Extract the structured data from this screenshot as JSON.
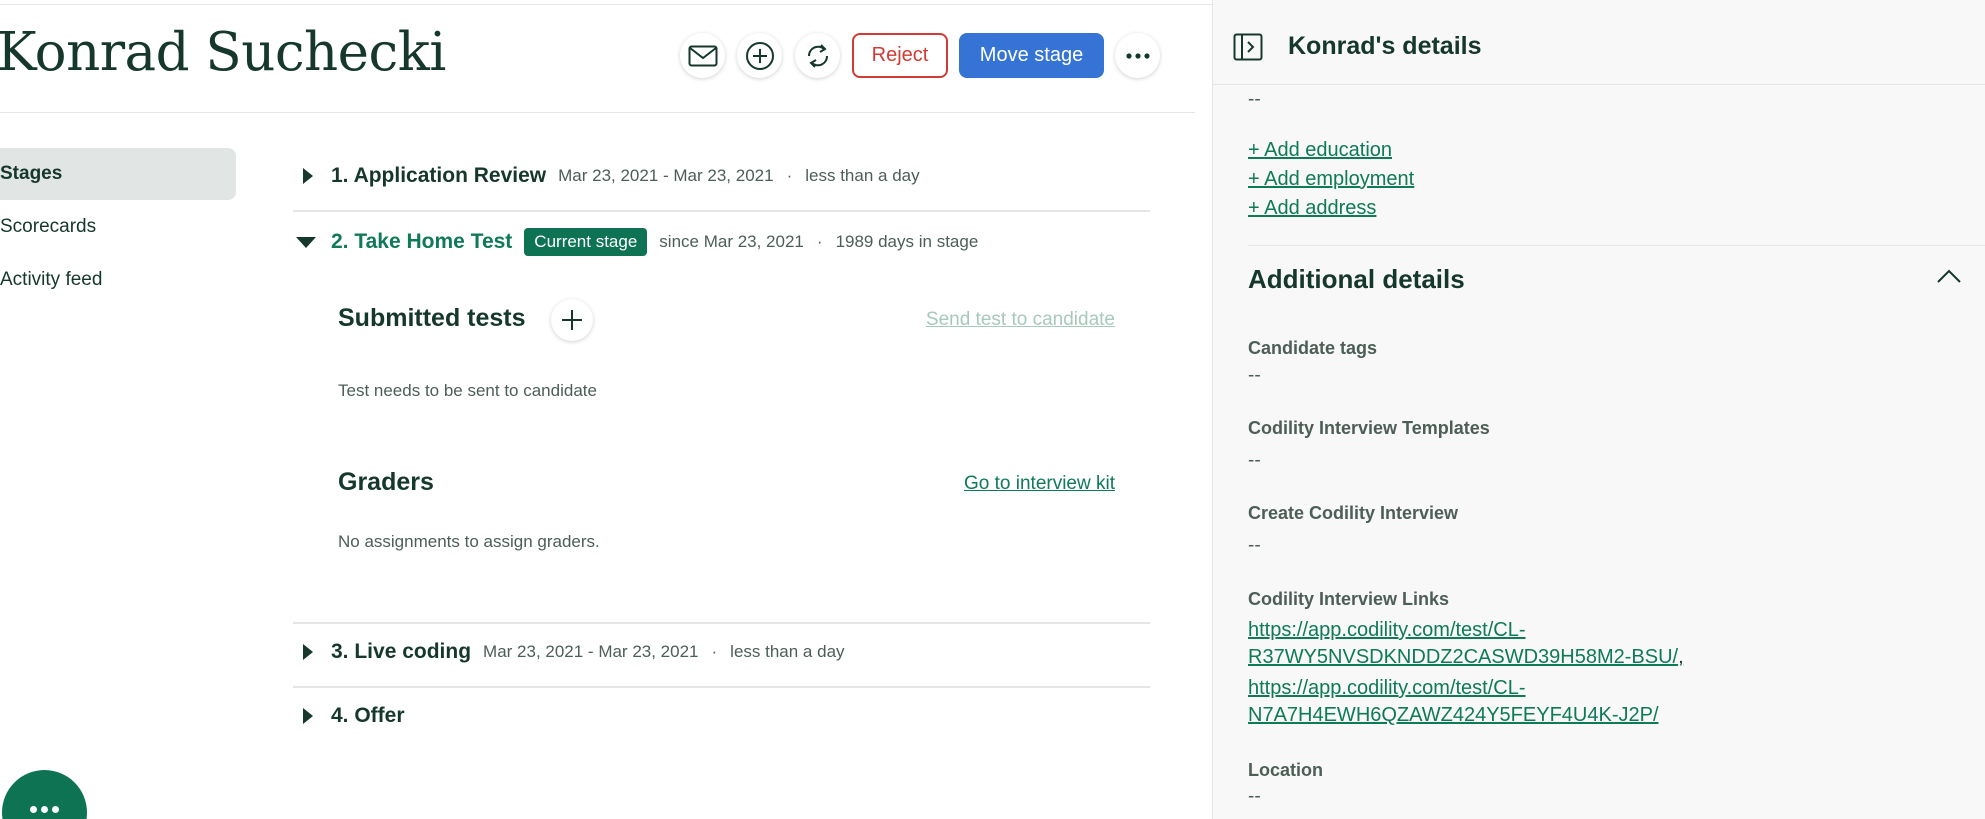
{
  "candidate": {
    "name": "Konrad Suchecki"
  },
  "actions": {
    "reject_label": "Reject",
    "move_stage_label": "Move stage"
  },
  "nav": {
    "items": [
      {
        "label": "Stages"
      },
      {
        "label": "Scorecards"
      },
      {
        "label": "Activity feed"
      }
    ]
  },
  "stages": [
    {
      "title": "1. Application Review",
      "dates": "Mar 23, 2021 - Mar 23, 2021",
      "duration": "less than a day"
    },
    {
      "title": "2. Take Home Test",
      "badge": "Current stage",
      "dates": "since Mar 23, 2021",
      "duration": "1989 days in stage"
    },
    {
      "title": "3. Live coding",
      "dates": "Mar 23, 2021 - Mar 23, 2021",
      "duration": "less than a day"
    },
    {
      "title": "4. Offer"
    }
  ],
  "take_home": {
    "submitted_tests_title": "Submitted tests",
    "send_test_link": "Send test to candidate",
    "test_status": "Test needs to be sent to candidate",
    "graders_title": "Graders",
    "interview_kit_link": "Go to interview kit",
    "graders_status": "No assignments to assign graders."
  },
  "details_panel": {
    "title": "Konrad's details",
    "top_value": "--",
    "add_links": [
      "+ Add education",
      "+ Add employment",
      "+ Add address"
    ],
    "additional_title": "Additional details",
    "fields": {
      "candidate_tags": {
        "label": "Candidate tags",
        "value": "--"
      },
      "interview_templates": {
        "label": "Codility Interview Templates",
        "value": "--"
      },
      "create_interview": {
        "label": "Create Codility Interview",
        "value": "--"
      },
      "interview_links": {
        "label": "Codility Interview Links",
        "links": [
          {
            "line1": "https://app.codility.com/test/CL-",
            "line2": "R37WY5NVSDKNDDZ2CASWD39H58M2-BSU/"
          },
          {
            "line1": "https://app.codility.com/test/CL-",
            "line2": "N7A7H4EWH6QZAWZ424Y5FEYF4U4K-J2P/"
          }
        ],
        "separator": ","
      },
      "location": {
        "label": "Location",
        "value": "--"
      }
    }
  },
  "colors": {
    "brand_green": "#0e7353",
    "link_green": "#0f7a57",
    "reject_red": "#d23a35",
    "primary_blue": "#3574d4",
    "text_dark": "#15372c"
  },
  "icons": [
    "mail-icon",
    "plus-circle-icon",
    "refresh-icon",
    "more-icon",
    "caret-right-icon",
    "caret-down-icon",
    "plus-icon",
    "panel-collapse-icon",
    "chevron-up-icon",
    "chat-icon"
  ]
}
